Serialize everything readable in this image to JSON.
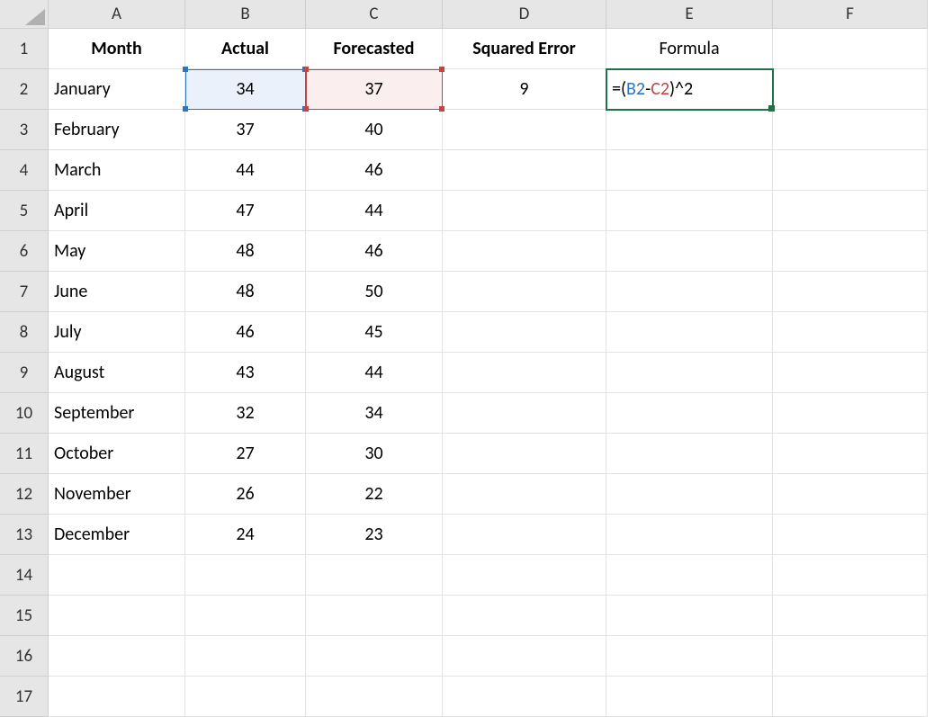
{
  "columns": [
    "A",
    "B",
    "C",
    "D",
    "E",
    "F"
  ],
  "row_numbers": [
    1,
    2,
    3,
    4,
    5,
    6,
    7,
    8,
    9,
    10,
    11,
    12,
    13,
    14,
    15,
    16,
    17
  ],
  "headers": {
    "A": "Month",
    "B": "Actual",
    "C": "Forecasted",
    "D": "Squared Error",
    "E": "Formula"
  },
  "rows": [
    {
      "month": "January",
      "actual": 34,
      "forecast": 37,
      "sqerr": 9
    },
    {
      "month": "February",
      "actual": 37,
      "forecast": 40
    },
    {
      "month": "March",
      "actual": 44,
      "forecast": 46
    },
    {
      "month": "April",
      "actual": 47,
      "forecast": 44
    },
    {
      "month": "May",
      "actual": 48,
      "forecast": 46
    },
    {
      "month": "June",
      "actual": 48,
      "forecast": 50
    },
    {
      "month": "July",
      "actual": 46,
      "forecast": 45
    },
    {
      "month": "August",
      "actual": 43,
      "forecast": 44
    },
    {
      "month": "September",
      "actual": 32,
      "forecast": 34
    },
    {
      "month": "October",
      "actual": 27,
      "forecast": 30
    },
    {
      "month": "November",
      "actual": 26,
      "forecast": 22
    },
    {
      "month": "December",
      "actual": 24,
      "forecast": 23
    }
  ],
  "formula": {
    "eq": "=",
    "open": "(",
    "ref1": "B2",
    "minus": "-",
    "ref2": "C2",
    "close": ")",
    "caret": "^",
    "exp": "2"
  }
}
